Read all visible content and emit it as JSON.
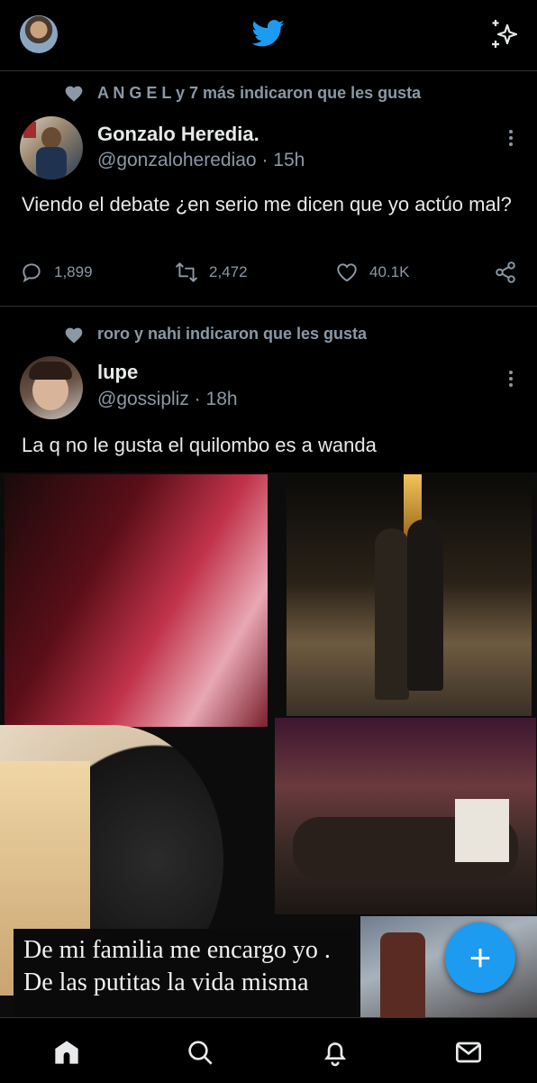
{
  "colors": {
    "accent": "#1d9bf0",
    "background": "#000000",
    "secondary_text": "#8b98a5",
    "divider": "#2f3336"
  },
  "header": {
    "logo": "twitter-bird-icon",
    "action": "sparkle-icon"
  },
  "tweets": [
    {
      "social_context": "A N G E L y 7 más indicaron que les gusta",
      "name": "Gonzalo Heredia.",
      "handle_time": "@gonzaloherediao · 15h",
      "text": "Viendo el debate ¿en serio me dicen que yo actúo mal?",
      "replies": "1,899",
      "retweets": "2,472",
      "likes": "40.1K"
    },
    {
      "social_context": "roro y nahi indicaron que les gusta",
      "name": "lupe",
      "handle_time": "@gossipliz · 18h",
      "text": "La q no le gusta el quilombo es a wanda",
      "media_caption": "De mi familia me encargo yo . De las putitas la vida misma"
    }
  ],
  "tabs": [
    "home-icon",
    "search-icon",
    "notifications-icon",
    "messages-icon"
  ],
  "fab": {
    "label": "+"
  }
}
